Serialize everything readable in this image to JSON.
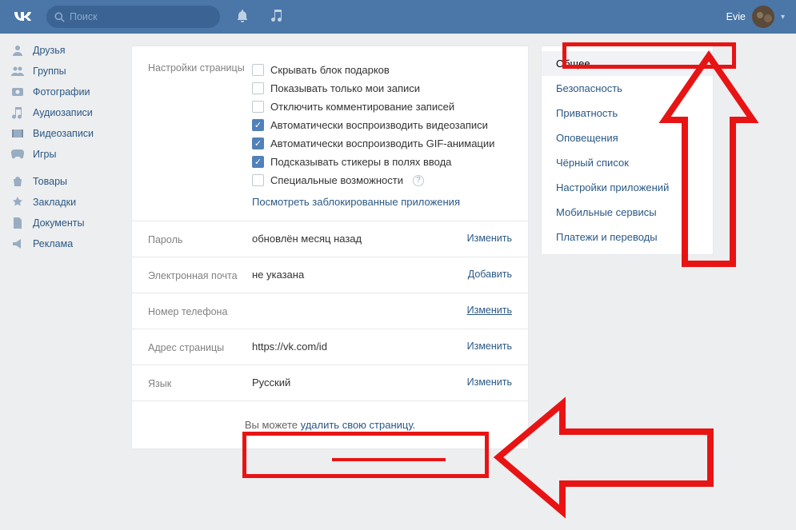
{
  "header": {
    "search_placeholder": "Поиск",
    "user_name": "Evie"
  },
  "sidebar": {
    "items": [
      {
        "label": "Друзья",
        "icon": "friends"
      },
      {
        "label": "Группы",
        "icon": "groups"
      },
      {
        "label": "Фотографии",
        "icon": "photos"
      },
      {
        "label": "Аудиозаписи",
        "icon": "audio"
      },
      {
        "label": "Видеозаписи",
        "icon": "video"
      },
      {
        "label": "Игры",
        "icon": "games"
      }
    ],
    "items2": [
      {
        "label": "Товары",
        "icon": "market"
      },
      {
        "label": "Закладки",
        "icon": "bookmarks"
      },
      {
        "label": "Документы",
        "icon": "docs"
      },
      {
        "label": "Реклама",
        "icon": "ads"
      }
    ]
  },
  "right_nav": {
    "items": [
      {
        "label": "Общее",
        "active": true
      },
      {
        "label": "Безопасность"
      },
      {
        "label": "Приватность"
      },
      {
        "label": "Оповещения"
      },
      {
        "label": "Чёрный список"
      },
      {
        "label": "Настройки приложений"
      },
      {
        "label": "Мобильные сервисы"
      },
      {
        "label": "Платежи и переводы"
      }
    ]
  },
  "settings": {
    "section_page_label": "Настройки страницы",
    "checkboxes": [
      {
        "label": "Скрывать блок подарков",
        "checked": false
      },
      {
        "label": "Показывать только мои записи",
        "checked": false
      },
      {
        "label": "Отключить комментирование записей",
        "checked": false
      },
      {
        "label": "Автоматически воспроизводить видеозаписи",
        "checked": true
      },
      {
        "label": "Автоматически воспроизводить GIF-анимации",
        "checked": true
      },
      {
        "label": "Подсказывать стикеры в полях ввода",
        "checked": true
      },
      {
        "label": "Специальные возможности",
        "checked": false,
        "help": true
      }
    ],
    "blocked_apps_link": "Посмотреть заблокированные приложения",
    "password": {
      "label": "Пароль",
      "value": "обновлён месяц назад",
      "action": "Изменить"
    },
    "email": {
      "label": "Электронная почта",
      "value": "не указана",
      "action": "Добавить"
    },
    "phone": {
      "label": "Номер телефона",
      "value": "",
      "action": "Изменить",
      "underline": true
    },
    "url": {
      "label": "Адрес страницы",
      "value": "https://vk.com/id",
      "action": "Изменить"
    },
    "lang": {
      "label": "Язык",
      "value": "Русский",
      "action": "Изменить"
    },
    "delete": {
      "prefix": "Вы можете ",
      "link": "удалить свою страницу."
    }
  }
}
